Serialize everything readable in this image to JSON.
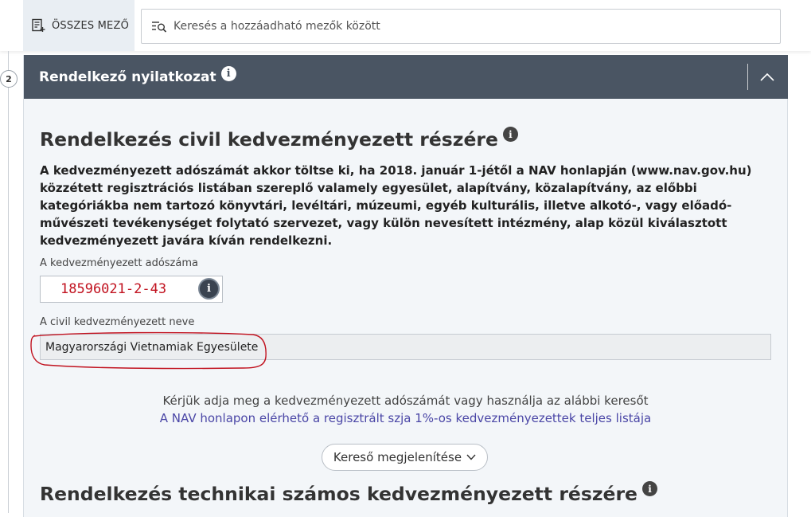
{
  "topbar": {
    "all_fields_label": "ÖSSZES MEZŐ",
    "search_placeholder": "Keresés a hozzáadható mezők között"
  },
  "step": {
    "number": "2"
  },
  "section": {
    "title": "Rendelkező nyilatkozat",
    "info_glyph": "i"
  },
  "civil": {
    "heading": "Rendelkezés civil kedvezményezett részére",
    "description": "A kedvezményezett adószámát akkor töltse ki, ha 2018. január 1-jétől a NAV honlapján (www.nav.gov.hu) közzétett regisztrációs listában szereplő valamely egyesület, alapítvány, közalapítvány, az előbbi kategóriákba nem tartozó könyvtári, levéltári, múzeumi, egyéb kulturális, illetve alkotó-, vagy előadó-művészeti tevékenységet folytató szervezet, vagy külön nevesített intézmény, alap közül kiválasztott kedvezményezett javára kíván rendelkezni.",
    "tax_label": "A kedvezményezett adószáma",
    "tax_value": "18596021-2-43",
    "name_label": "A civil kedvezményezett neve",
    "name_value": "Magyarországi Vietnamiak Egyesülete",
    "hint": "Kérjük adja meg a kedvezményezett adószámát vagy használja az alábbi keresőt",
    "link": "A NAV honlapon elérhető a regisztrált szja 1%-os kedvezményezettek teljes listája",
    "search_toggle": "Kereső megjelenítése"
  },
  "technical": {
    "heading": "Rendelkezés technikai számos kedvezményezett részére"
  },
  "colors": {
    "header_bg": "#4a5563",
    "annotation_red": "#c1121f",
    "link": "#4a46a6"
  }
}
